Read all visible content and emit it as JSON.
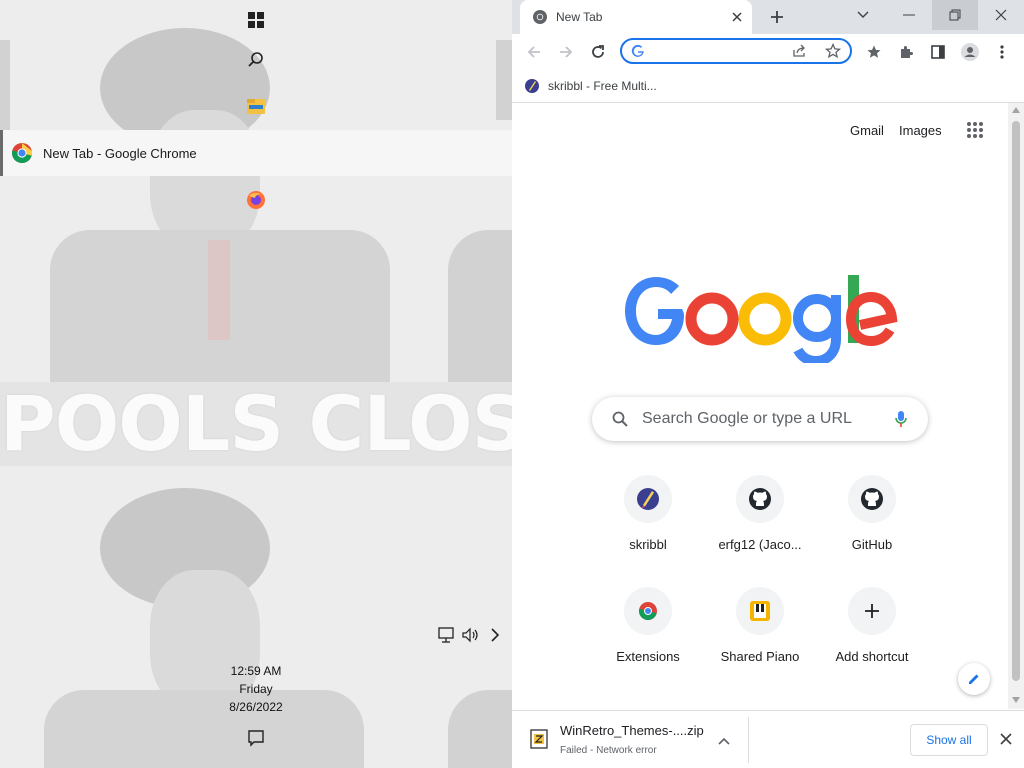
{
  "desktop": {
    "banner_text": "POOLS CLOSED POOLS CLOSED",
    "taskbar": {
      "chrome_window_label": "New Tab - Google Chrome"
    },
    "clock": {
      "time": "12:59 AM",
      "day": "Friday",
      "date": "8/26/2022"
    },
    "icons": [
      "windows-start-icon",
      "search-icon",
      "file-explorer-icon",
      "firefox-icon",
      "network-icon",
      "volume-icon",
      "chevron-right-icon",
      "notification-icon"
    ]
  },
  "browser": {
    "tab_title": "New Tab",
    "bookmarks": [
      {
        "label": "skribbl - Free Multi..."
      }
    ],
    "omnibox": {
      "value": ""
    },
    "ntp": {
      "top_links": {
        "gmail": "Gmail",
        "images": "Images"
      },
      "search_placeholder": "Search Google or type a URL",
      "shortcuts": [
        {
          "name": "skribbl"
        },
        {
          "name": "erfg12 (Jaco..."
        },
        {
          "name": "GitHub"
        },
        {
          "name": "Extensions"
        },
        {
          "name": "Shared Piano"
        },
        {
          "name": "Add shortcut"
        }
      ]
    },
    "download": {
      "filename": "WinRetro_Themes-....zip",
      "status": "Failed - Network error",
      "show_all": "Show all"
    },
    "colors": {
      "blue": "#4285F4",
      "red": "#EA4335",
      "yellow": "#FBBC05",
      "green": "#34A853",
      "accent": "#1a73e8"
    }
  }
}
